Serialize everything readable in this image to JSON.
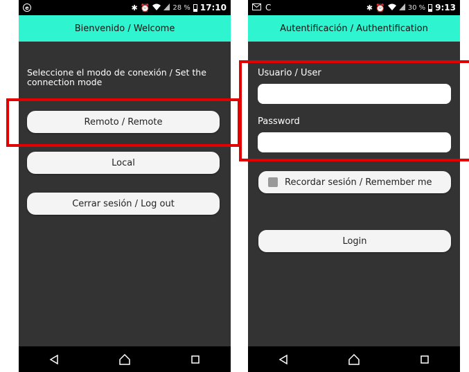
{
  "phone1": {
    "status": {
      "time": "17:10",
      "battery": "28 %",
      "battery_level": 0.28
    },
    "title": "Bienvenido / Welcome",
    "prompt": "Seleccione el modo de conexión / Set the connection mode",
    "buttons": {
      "remote": "Remoto / Remote",
      "local": "Local",
      "logout": "Cerrar sesión / Log out"
    }
  },
  "phone2": {
    "status": {
      "time": "9:13",
      "battery": "30 %",
      "battery_level": 0.3
    },
    "title": "Autentificación / Authentification",
    "user_label": "Usuario / User",
    "user_value": "",
    "password_label": "Password",
    "password_value": "",
    "remember_label": "Recordar sesión / Remember me",
    "remember_checked": false,
    "login_label": "Login"
  },
  "colors": {
    "accent": "#2ef4cf",
    "background": "#333333",
    "highlight": "#e20000",
    "button": "#f4f4f4"
  },
  "icons": [
    "circle-e-icon",
    "bluetooth-icon",
    "alarm-icon",
    "wifi-icon",
    "signal-icon",
    "battery-icon",
    "mail-icon",
    "sync-icon",
    "back-icon",
    "home-icon",
    "recents-icon"
  ]
}
